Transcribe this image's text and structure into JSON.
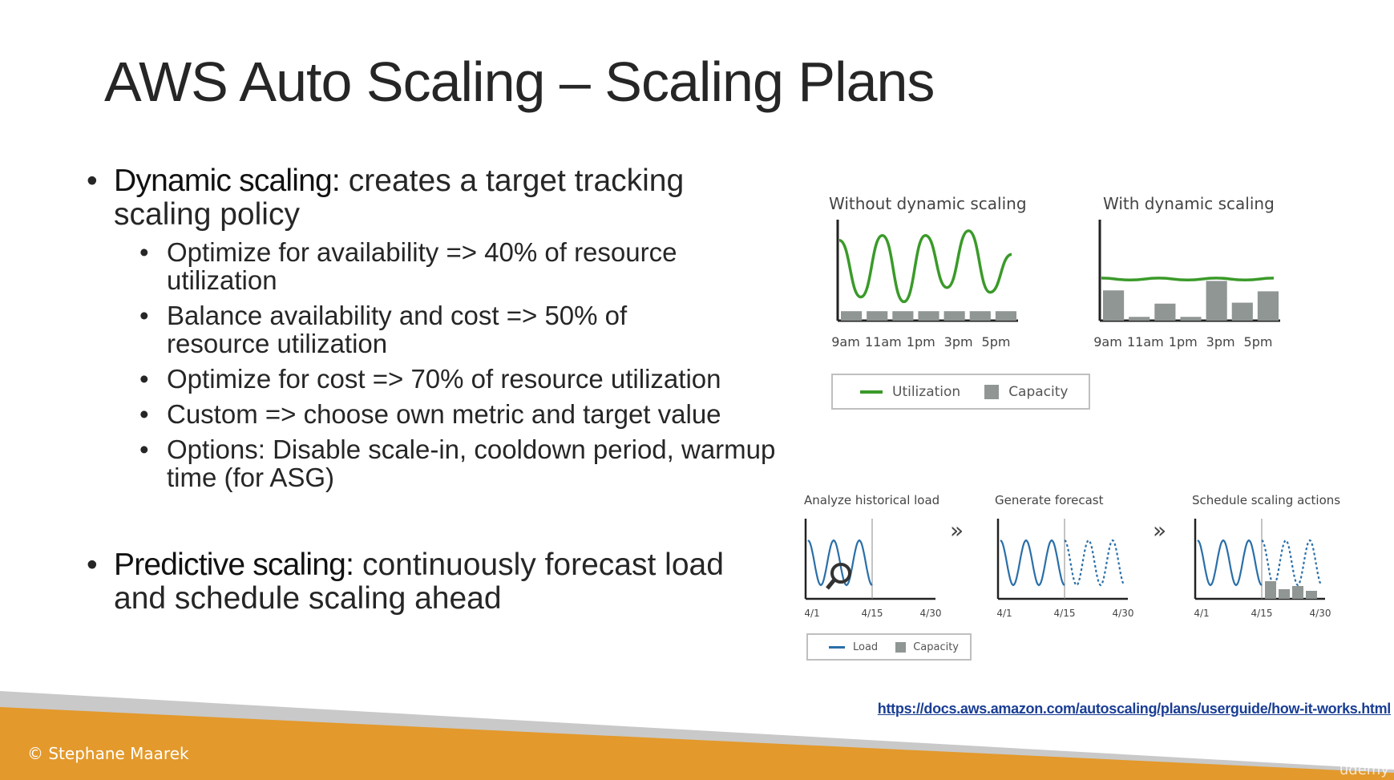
{
  "slide": {
    "title": "AWS Auto Scaling – Scaling Plans"
  },
  "bullets": {
    "dynamic_lead": "Dynamic scaling:",
    "dynamic_text": " creates a target tracking scaling policy",
    "sub": [
      "Optimize for availability => 40% of resource utilization",
      "Balance availability and cost => 50% of resource utilization",
      "Optimize for cost => 70% of resource utilization",
      "Custom => choose own metric and target value",
      "Options: Disable scale-in, cooldown period, warmup time (for ASG)"
    ],
    "predictive_lead": "Predictive scaling:",
    "predictive_text": " continuously forecast load and schedule scaling ahead"
  },
  "dynamic_charts": {
    "without_title": "Without dynamic scaling",
    "with_title": "With dynamic scaling",
    "x_ticks": [
      "9am",
      "11am",
      "1pm",
      "3pm",
      "5pm"
    ],
    "legend_utilization": "Utilization",
    "legend_capacity": "Capacity",
    "colors": {
      "utilization": "#3a9a29",
      "capacity": "#8f9694"
    }
  },
  "chart_data": [
    {
      "type": "line",
      "title": "Without dynamic scaling",
      "categories": [
        "9am",
        "11am",
        "1pm",
        "3pm",
        "5pm"
      ],
      "series": [
        {
          "name": "Utilization",
          "values": [
            0.85,
            0.25,
            0.9,
            0.2,
            0.9,
            0.35,
            0.95,
            0.3,
            0.7
          ]
        },
        {
          "name": "Capacity",
          "values": [
            0.1,
            0.1,
            0.1,
            0.1,
            0.1,
            0.1,
            0.1
          ]
        }
      ]
    },
    {
      "type": "line",
      "title": "With dynamic scaling",
      "categories": [
        "9am",
        "11am",
        "1pm",
        "3pm",
        "5pm"
      ],
      "series": [
        {
          "name": "Utilization",
          "values": [
            0.45,
            0.43,
            0.45,
            0.43,
            0.45,
            0.43,
            0.45
          ]
        },
        {
          "name": "Capacity",
          "values": [
            0.32,
            0.04,
            0.18,
            0.04,
            0.42,
            0.19,
            0.31
          ]
        }
      ]
    }
  ],
  "predictive_charts": {
    "panels": [
      {
        "title": "Analyze historical load"
      },
      {
        "title": "Generate forecast"
      },
      {
        "title": "Schedule scaling actions"
      }
    ],
    "x_ticks": [
      "4/1",
      "4/15",
      "4/30"
    ],
    "arrow": "»",
    "legend_load": "Load",
    "legend_capacity": "Capacity",
    "colors": {
      "load": "#2a6fa8",
      "capacity": "#8f9694"
    }
  },
  "footer": {
    "link": "https://docs.aws.amazon.com/autoscaling/plans/userguide/how-it-works.html",
    "copyright": "© Stephane Maarek",
    "watermark": "üdemy"
  }
}
